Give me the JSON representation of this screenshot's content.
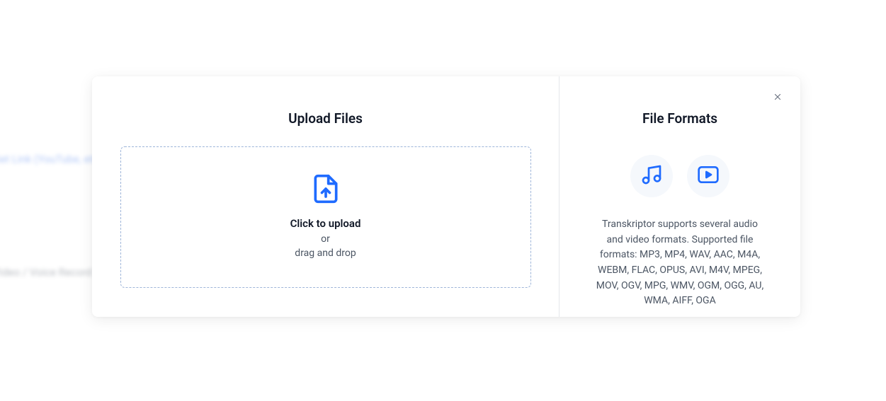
{
  "upload": {
    "title": "Upload Files",
    "click_label": "Click to upload",
    "or_label": "or",
    "drag_label": "drag and drop"
  },
  "formats": {
    "title": "File Formats",
    "description": "Transkriptor supports several audio and video formats. Supported file formats: MP3, MP4, WAV, AAC, M4A, WEBM, FLAC, OPUS, AVI, M4V, MPEG, MOV, OGV, MPG, WMV, OGM, OGG, AU, WMA, AIFF, OGA"
  },
  "icons": {
    "close": "close-icon",
    "file_upload": "file-upload-icon",
    "music": "music-icon",
    "video": "video-icon"
  }
}
